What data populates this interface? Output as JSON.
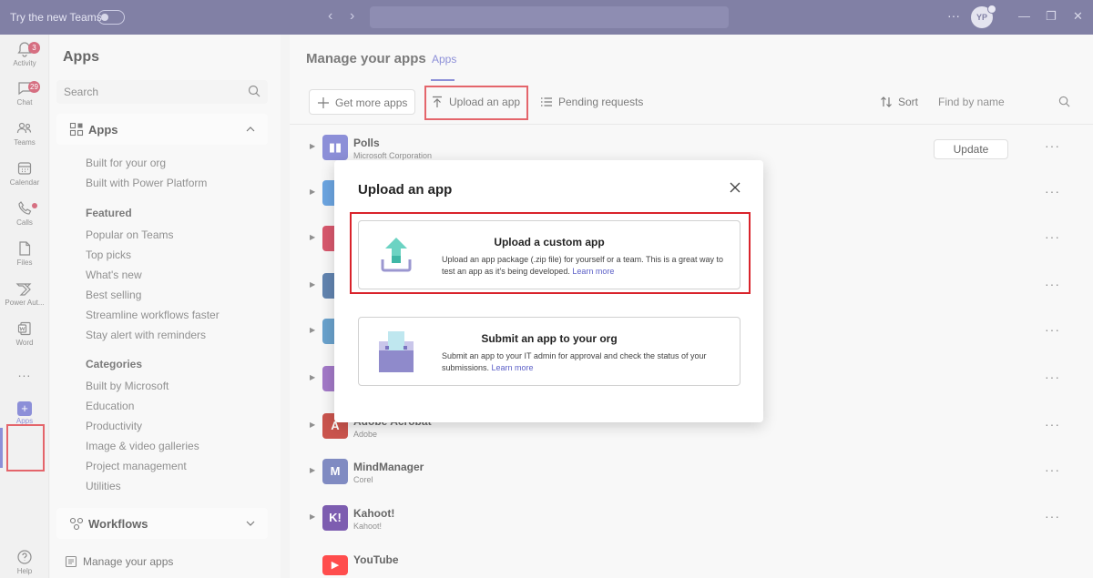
{
  "titlebar": {
    "try_new_teams": "Try the new Teams",
    "avatar_initials": "YP"
  },
  "rail": {
    "items": [
      {
        "label": "Activity",
        "badge": "3"
      },
      {
        "label": "Chat",
        "badge": "29"
      },
      {
        "label": "Teams"
      },
      {
        "label": "Calendar"
      },
      {
        "label": "Calls"
      },
      {
        "label": "Files"
      },
      {
        "label": "Power Aut..."
      },
      {
        "label": "Word"
      },
      {
        "label": "..."
      },
      {
        "label": "Apps"
      },
      {
        "label": "Help"
      }
    ]
  },
  "left_panel": {
    "title": "Apps",
    "search_placeholder": "Search",
    "apps_section": "Apps",
    "org_items": [
      "Built for your org",
      "Built with Power Platform"
    ],
    "featured_heading": "Featured",
    "featured_items": [
      "Popular on Teams",
      "Top picks",
      "What's new",
      "Best selling",
      "Streamline workflows faster",
      "Stay alert with reminders"
    ],
    "categories_heading": "Categories",
    "category_items": [
      "Built by Microsoft",
      "Education",
      "Productivity",
      "Image & video galleries",
      "Project management",
      "Utilities"
    ],
    "workflows_section": "Workflows",
    "manage_apps": "Manage your apps"
  },
  "main": {
    "title": "Manage your apps",
    "tab": "Apps",
    "toolbar": {
      "get_more_apps": "Get more apps",
      "upload_an_app": "Upload an app",
      "pending_requests": "Pending requests",
      "sort": "Sort",
      "find_placeholder": "Find by name"
    },
    "rows": [
      {
        "name": "Polls",
        "publisher": "Microsoft Corporation",
        "color": "#5b5fc7",
        "glyph": "▮▮",
        "action": "Update"
      },
      {
        "name": "Adobe Acrobat",
        "publisher": "Adobe",
        "color": "#b30b00",
        "glyph": "A"
      },
      {
        "name": "MindManager",
        "publisher": "Corel",
        "color": "#4a5aa8",
        "glyph": "M"
      },
      {
        "name": "Kahoot!",
        "publisher": "Kahoot!",
        "color": "#46178f",
        "glyph": "K!"
      },
      {
        "name": "YouTube",
        "publisher": "",
        "color": "#ff0000",
        "glyph": "▶"
      }
    ]
  },
  "modal": {
    "title": "Upload an app",
    "custom": {
      "title": "Upload a custom app",
      "desc": "Upload an app package (.zip file) for yourself or a team. This is a great way to test an app as it's being developed. ",
      "learn_more": "Learn more"
    },
    "org": {
      "title": "Submit an app to your org",
      "desc": "Submit an app to your IT admin for approval and check the status of your submissions. ",
      "learn_more": "Learn more"
    }
  }
}
